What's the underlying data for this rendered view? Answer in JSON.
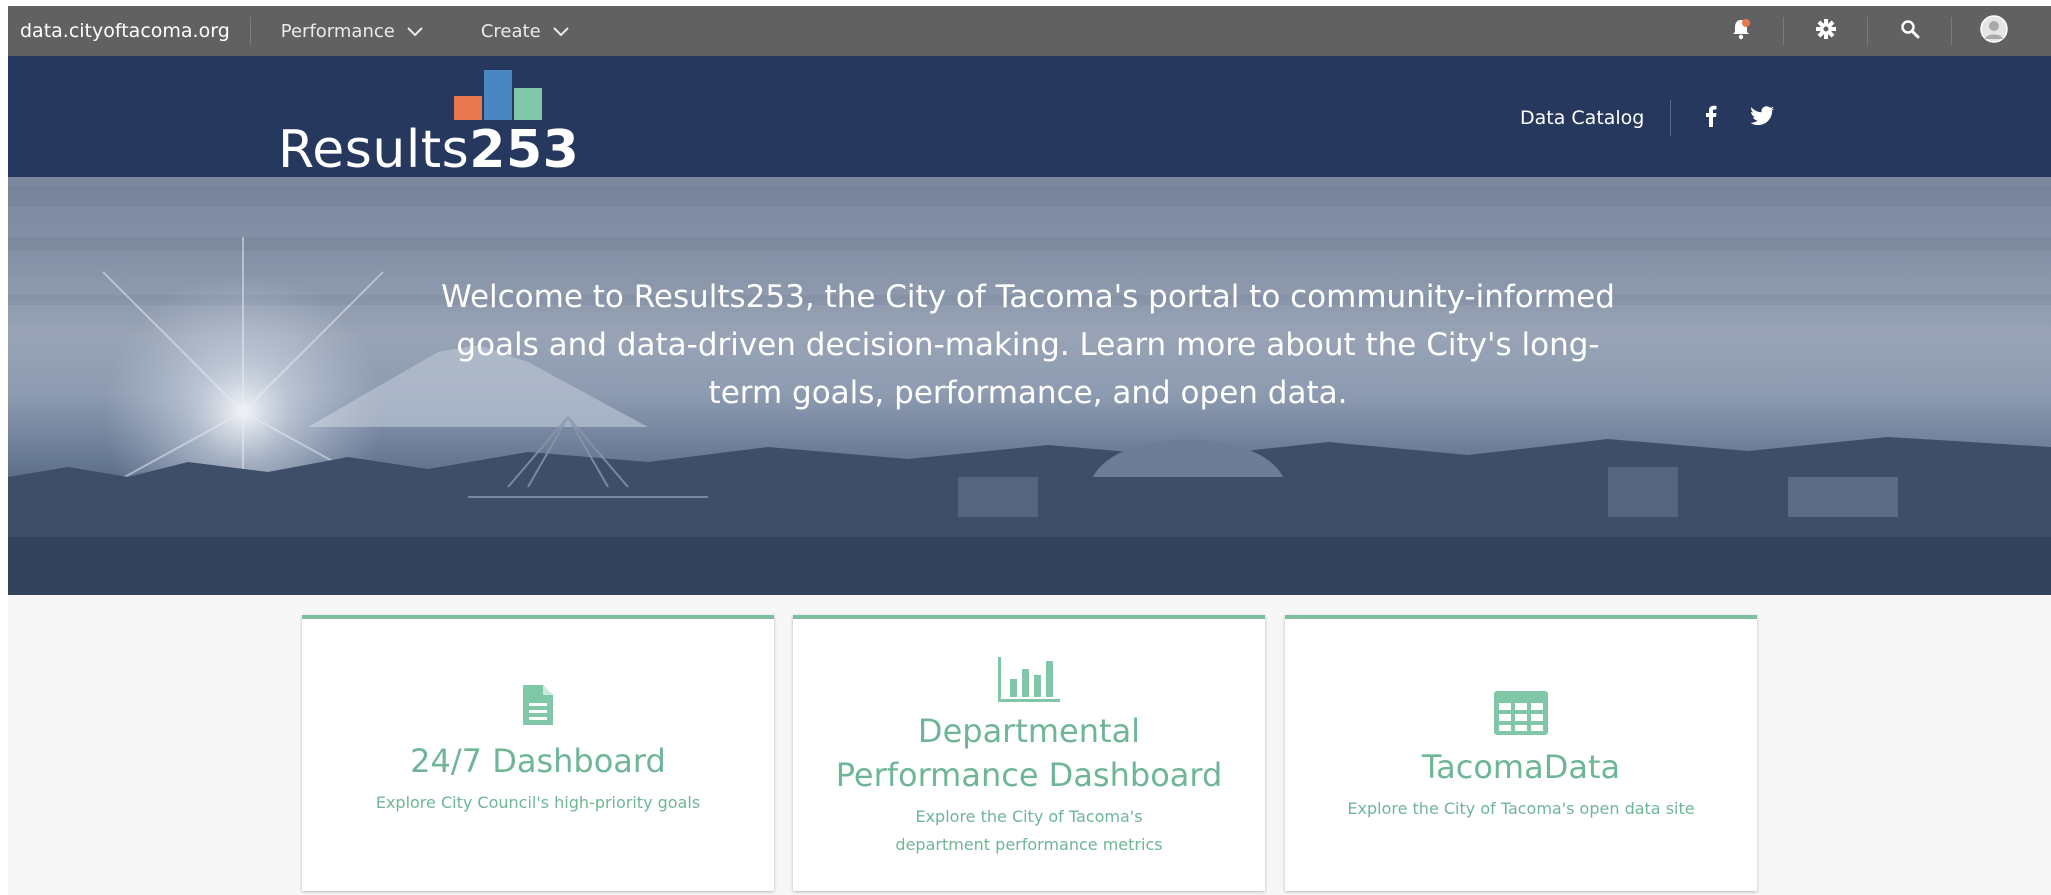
{
  "topbar": {
    "site": "data.cityoftacoma.org",
    "menus": [
      {
        "label": "Performance"
      },
      {
        "label": "Create"
      }
    ],
    "icons": [
      "notification-bell-icon",
      "gear-icon",
      "search-icon",
      "user-avatar-icon"
    ]
  },
  "brand": {
    "logo_word": "Results",
    "logo_number": "253",
    "nav_link": "Data Catalog",
    "social": [
      "facebook-icon",
      "twitter-icon"
    ],
    "colors": {
      "header_bg": "#27385f",
      "bar1": "#e8774e",
      "bar2": "#4a86c2",
      "bar3": "#7fc7a6"
    }
  },
  "hero": {
    "text": "Welcome to Results253, the City of Tacoma's portal to community-informed goals and data-driven decision-making. Learn more about the City's long-term goals, performance, and open data."
  },
  "cards": [
    {
      "icon": "document-icon",
      "title": "24/7 Dashboard",
      "description": "Explore City Council's high-priority goals"
    },
    {
      "icon": "bar-chart-icon",
      "title": "Departmental Performance Dashboard",
      "description": "Explore the City of Tacoma's department performance metrics"
    },
    {
      "icon": "table-grid-icon",
      "title": "TacomaData",
      "description": "Explore the City of Tacoma's open data site"
    }
  ],
  "accent_color": "#6fb697"
}
